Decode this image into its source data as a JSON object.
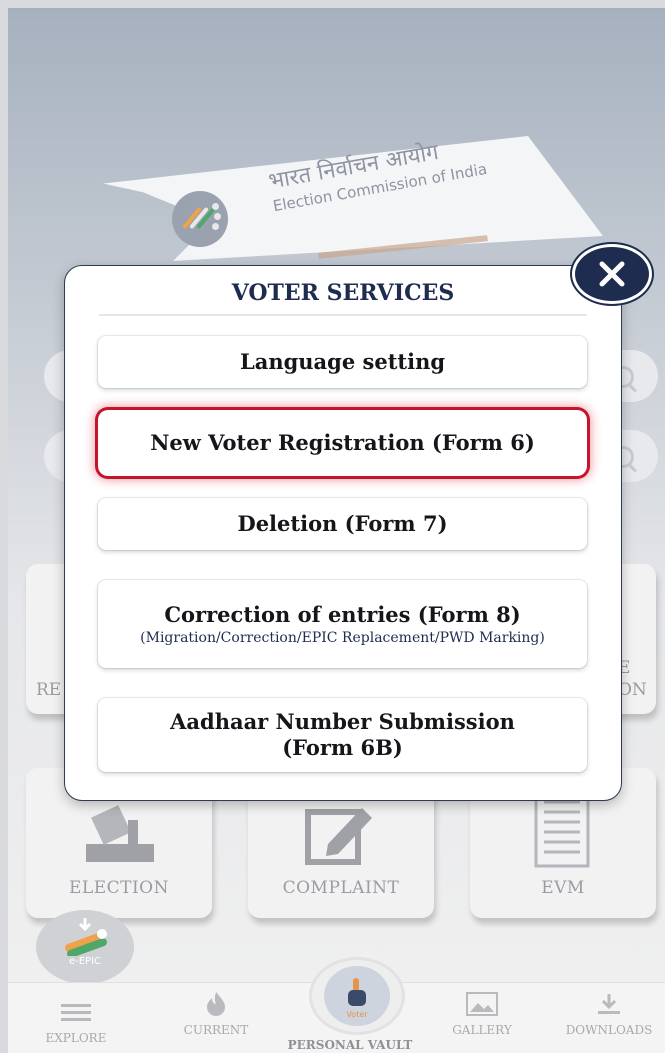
{
  "banner": {
    "hindi": "भारत निर्वाचन आयोग",
    "english": "Election Commission of India"
  },
  "tiles": {
    "row1_left_partial": "RE",
    "row1_right_partial_top": "E",
    "row1_right_partial_bottom": "ON",
    "election": "ELECTION",
    "complaint": "COMPLAINT",
    "evm": "EVM"
  },
  "epic": {
    "label": "e-EPIC"
  },
  "nav": {
    "explore": "EXPLORE",
    "current": "CURRENT",
    "personal_vault": "PERSONAL VAULT",
    "gallery": "GALLERY",
    "downloads": "DOWNLOADS",
    "center_badge": "Voter"
  },
  "modal": {
    "title": "VOTER SERVICES",
    "options": [
      {
        "label": "Language setting"
      },
      {
        "label": "New Voter Registration (Form 6)"
      },
      {
        "label": "Deletion (Form 7)"
      },
      {
        "label": "Correction of entries (Form 8)",
        "sub": "(Migration/Correction/EPIC Replacement/PWD Marking)"
      },
      {
        "label": "Aadhaar Number Submission (Form 6B)"
      }
    ]
  },
  "colors": {
    "navy": "#1d2c4f",
    "highlight": "#c4152a"
  }
}
